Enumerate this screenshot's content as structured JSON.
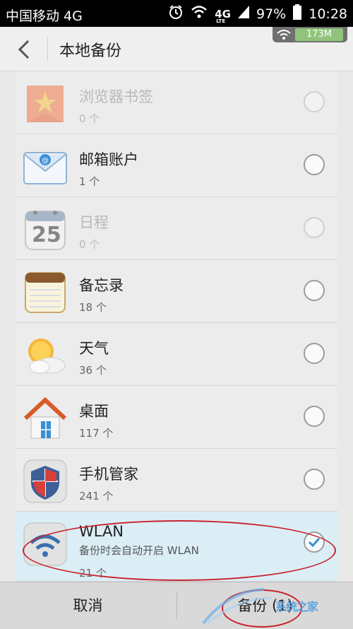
{
  "status_bar": {
    "carrier": "中国移动 4G",
    "network": "4G",
    "network_sub": "LTE",
    "battery": "97%",
    "time": "10:28"
  },
  "header": {
    "title": "本地备份",
    "net_speed": "173M"
  },
  "items": [
    {
      "name": "浏览器书签",
      "count": "0 个",
      "icon": "bookmark-icon",
      "disabled": true,
      "selected": false
    },
    {
      "name": "邮箱账户",
      "count": "1 个",
      "icon": "mail-icon",
      "disabled": false,
      "selected": false
    },
    {
      "name": "日程",
      "count": "0 个",
      "icon": "calendar-icon",
      "disabled": true,
      "selected": false,
      "calendar_day": "25"
    },
    {
      "name": "备忘录",
      "count": "18 个",
      "icon": "notepad-icon",
      "disabled": false,
      "selected": false
    },
    {
      "name": "天气",
      "count": "36 个",
      "icon": "weather-icon",
      "disabled": false,
      "selected": false
    },
    {
      "name": "桌面",
      "count": "117 个",
      "icon": "home-icon",
      "disabled": false,
      "selected": false
    },
    {
      "name": "手机管家",
      "count": "241 个",
      "icon": "shield-icon",
      "disabled": false,
      "selected": false
    },
    {
      "name": "WLAN",
      "desc": "备份时会自动开启 WLAN",
      "count": "21 个",
      "icon": "wlan-icon",
      "disabled": false,
      "selected": true
    }
  ],
  "bottom_bar": {
    "cancel_label": "取消",
    "backup_label": "备份 (1)"
  },
  "watermark": {
    "text": "系统之家"
  },
  "colors": {
    "accent_check": "#3a8fc6",
    "annotation_red": "#c8232c",
    "selected_row": "#dbeef6"
  }
}
